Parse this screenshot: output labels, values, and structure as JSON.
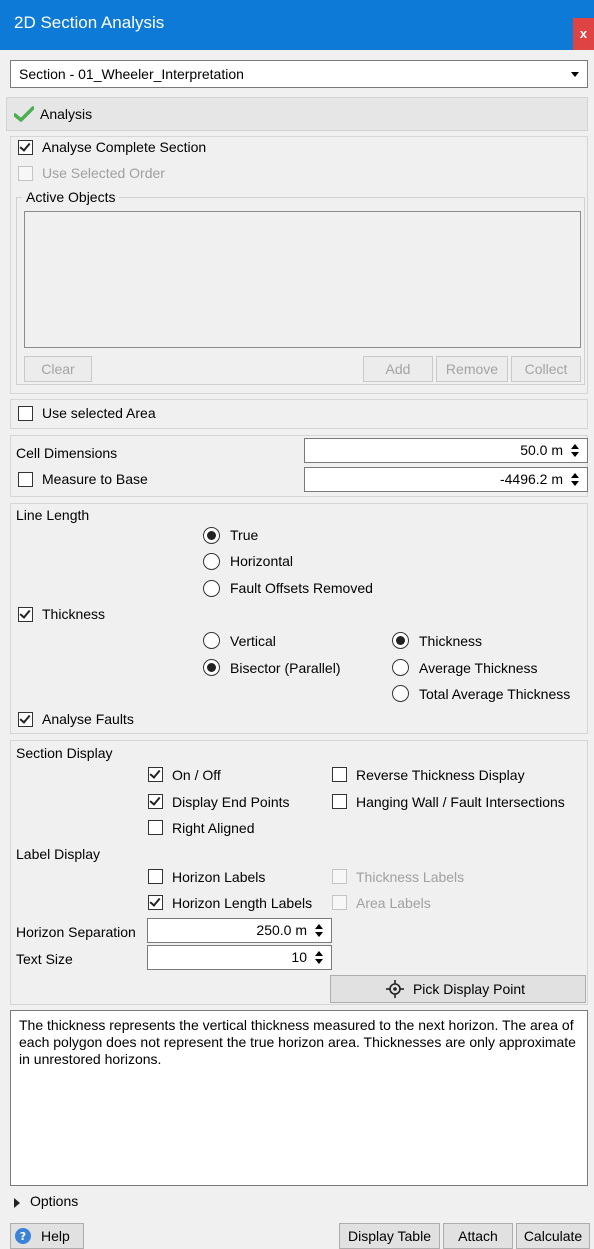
{
  "window": {
    "title": "2D Section Analysis",
    "close_glyph": "x"
  },
  "section_select": {
    "value": "Section - 01_Wheeler_Interpretation"
  },
  "analysis_header": {
    "label": "Analysis"
  },
  "analysis": {
    "complete_section": {
      "label": "Analyse Complete Section",
      "checked": true
    },
    "selected_order": {
      "label": "Use Selected Order",
      "checked": false,
      "disabled": true
    },
    "active_objects": {
      "label": "Active Objects",
      "buttons": {
        "clear": "Clear",
        "add": "Add",
        "remove": "Remove",
        "collect": "Collect"
      }
    }
  },
  "use_selected_area": {
    "label": "Use selected Area",
    "checked": false
  },
  "cell_dimensions": {
    "label": "Cell Dimensions",
    "value": "50.0 m"
  },
  "measure_to_base": {
    "label": "Measure to Base",
    "checked": false,
    "value": "-4496.2 m"
  },
  "line_length": {
    "label": "Line Length",
    "options": {
      "true": "True",
      "horizontal": "Horizontal",
      "fault_offsets": "Fault Offsets Removed"
    },
    "selected": "True"
  },
  "thickness": {
    "label": "Thickness",
    "checked": true,
    "direction": {
      "vertical": "Vertical",
      "bisector": "Bisector (Parallel)",
      "selected": "Bisector (Parallel)"
    },
    "mode": {
      "thickness": "Thickness",
      "average": "Average Thickness",
      "total_average": "Total Average Thickness",
      "selected": "Thickness"
    }
  },
  "analyse_faults": {
    "label": "Analyse Faults",
    "checked": true
  },
  "section_display": {
    "label": "Section Display",
    "on_off": "On / Off",
    "display_end_points": "Display End Points",
    "right_aligned": "Right Aligned",
    "reverse_thickness": "Reverse Thickness Display",
    "hanging_wall": "Hanging Wall / Fault Intersections"
  },
  "label_display": {
    "label": "Label Display",
    "horizon_labels": "Horizon Labels",
    "horizon_length_labels": "Horizon Length Labels",
    "thickness_labels": "Thickness Labels",
    "area_labels": "Area Labels"
  },
  "horizon_separation": {
    "label": "Horizon Separation",
    "value": "250.0 m"
  },
  "text_size": {
    "label": "Text Size",
    "value": "10"
  },
  "pick_display_point": {
    "label": "Pick Display Point"
  },
  "description": "The thickness represents the vertical thickness measured to the next horizon. The area of each polygon does not represent the true horizon area. Thicknesses are only approximate in unrestored horizons.",
  "options": {
    "label": "Options"
  },
  "footer": {
    "help": "Help",
    "display_table": "Display Table",
    "attach": "Attach",
    "calculate": "Calculate"
  },
  "colors": {
    "title_bar": "#0c7ad6",
    "close_button": "#e04343",
    "check_mark": "#4caf50",
    "help_icon": "#3b82d8"
  }
}
